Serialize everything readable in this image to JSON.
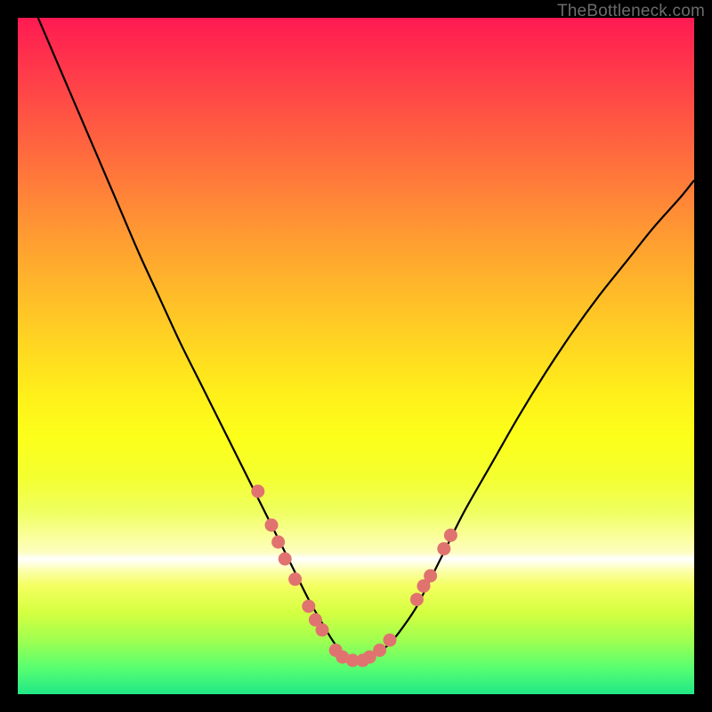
{
  "watermark": "TheBottleneck.com",
  "colors": {
    "curve_stroke": "#000000",
    "marker_fill": "#e0736f",
    "marker_stroke": "#c95a56"
  },
  "chart_data": {
    "type": "line",
    "title": "",
    "xlabel": "",
    "ylabel": "",
    "xlim": [
      0,
      100
    ],
    "ylim": [
      0,
      100
    ],
    "grid": false,
    "legend": false,
    "series": [
      {
        "name": "bottleneck-curve",
        "x": [
          0,
          3,
          6,
          9,
          12,
          15,
          18,
          21,
          24,
          27,
          30,
          33,
          36,
          39,
          41,
          43,
          45,
          46.5,
          48,
          49.5,
          51,
          53,
          55,
          57,
          59,
          61,
          63,
          66,
          70,
          74,
          78,
          82,
          86,
          90,
          94,
          98,
          100
        ],
        "values": [
          107,
          100,
          93,
          86,
          79,
          72,
          65,
          58.5,
          52,
          46,
          40,
          34,
          28,
          22,
          18,
          14,
          10.5,
          8,
          6,
          5,
          5,
          6,
          7.5,
          10,
          13,
          17,
          21,
          27,
          34,
          41,
          47.5,
          53.5,
          59,
          64,
          69,
          73.5,
          76
        ]
      }
    ],
    "markers": [
      {
        "x": 35.5,
        "y": 30.0
      },
      {
        "x": 37.5,
        "y": 25.0
      },
      {
        "x": 38.5,
        "y": 22.5
      },
      {
        "x": 39.5,
        "y": 20.0
      },
      {
        "x": 41.0,
        "y": 17.0
      },
      {
        "x": 43.0,
        "y": 13.0
      },
      {
        "x": 44.0,
        "y": 11.0
      },
      {
        "x": 45.0,
        "y": 9.5
      },
      {
        "x": 47.0,
        "y": 6.5
      },
      {
        "x": 48.0,
        "y": 5.5
      },
      {
        "x": 49.5,
        "y": 5.0
      },
      {
        "x": 51.0,
        "y": 5.0
      },
      {
        "x": 52.0,
        "y": 5.5
      },
      {
        "x": 53.5,
        "y": 6.5
      },
      {
        "x": 55.0,
        "y": 8.0
      },
      {
        "x": 59.0,
        "y": 14.0
      },
      {
        "x": 60.0,
        "y": 16.0
      },
      {
        "x": 61.0,
        "y": 17.5
      },
      {
        "x": 63.0,
        "y": 21.5
      },
      {
        "x": 64.0,
        "y": 23.5
      }
    ]
  }
}
